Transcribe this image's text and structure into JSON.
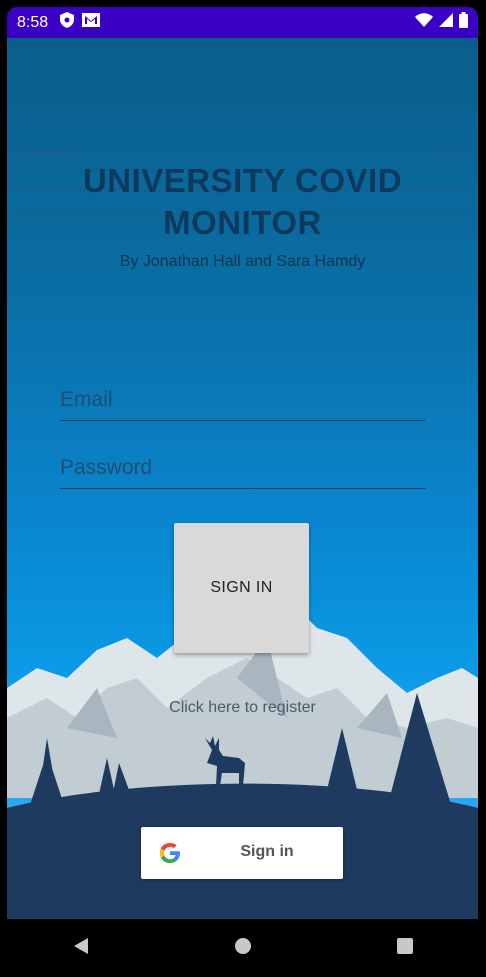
{
  "status_bar": {
    "time": "8:58",
    "left_icons": [
      "shield-icon",
      "gmail-icon"
    ],
    "right_icons": [
      "wifi-icon",
      "signal-icon",
      "battery-icon"
    ],
    "color": "#3a00c4"
  },
  "app": {
    "title": "UNIVERSITY COVID MONITOR",
    "subtitle": "By Jonathan Hall and Sara Hamdy",
    "email_placeholder": "Email",
    "password_placeholder": "Password",
    "sign_in_label": "SIGN IN",
    "register_link": "Click here to register",
    "google_sign_in_label": "Sign in"
  },
  "nav_bar": {
    "items": [
      "back-icon",
      "home-icon",
      "recents-icon"
    ]
  },
  "colors": {
    "sky_top": "#0a5e8a",
    "sky_bottom": "#2aa7ee",
    "hill": "#1f3a5f",
    "snow": "#dfe6ea"
  }
}
